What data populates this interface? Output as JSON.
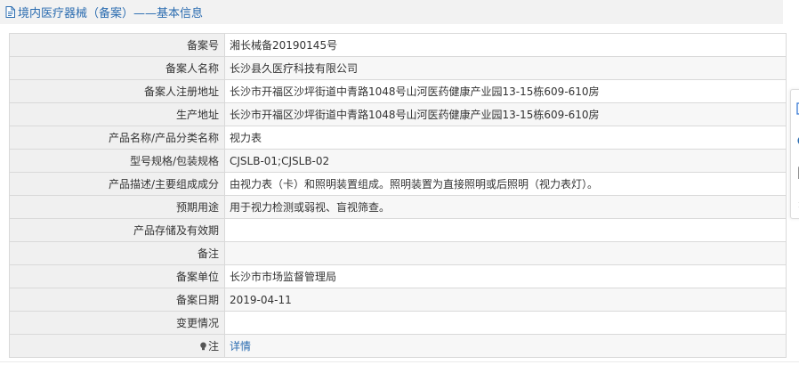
{
  "header": {
    "title": "境内医疗器械（备案）——基本信息",
    "icon": "document-icon"
  },
  "rows": [
    {
      "label": "备案号",
      "value": "湘长械备20190145号"
    },
    {
      "label": "备案人名称",
      "value": "长沙县久医疗科技有限公司"
    },
    {
      "label": "备案人注册地址",
      "value": "长沙市开福区沙坪街道中青路1048号山河医药健康产业园13-15栋609-610房"
    },
    {
      "label": "生产地址",
      "value": "长沙市开福区沙坪街道中青路1048号山河医药健康产业园13-15栋609-610房"
    },
    {
      "label": "产品名称/产品分类名称",
      "value": "视力表"
    },
    {
      "label": "型号规格/包装规格",
      "value": "CJSLB-01;CJSLB-02"
    },
    {
      "label": "产品描述/主要组成成分",
      "value": "由视力表（卡）和照明装置组成。照明装置为直接照明或后照明（视力表灯）。"
    },
    {
      "label": "预期用途",
      "value": "用于视力检测或弱视、盲视筛查。"
    },
    {
      "label": "产品存储及有效期",
      "value": ""
    },
    {
      "label": "备注",
      "value": ""
    },
    {
      "label": "备案单位",
      "value": "长沙市市场监督管理局"
    },
    {
      "label": "备案日期",
      "value": "2019-04-11"
    },
    {
      "label": "变更情况",
      "value": ""
    }
  ],
  "note_row": {
    "icon": "lightbulb-icon",
    "label": "注",
    "link_text": "详情"
  },
  "side_toolbar": {
    "icons": [
      "note-icon",
      "circle-icon",
      "bookmark-icon",
      "chevron-icon"
    ]
  },
  "colors": {
    "link": "#2b6cb0",
    "label_bg": "#f0f0f0",
    "border": "#d9d9d9",
    "title_bg": "#f2f2f2"
  }
}
